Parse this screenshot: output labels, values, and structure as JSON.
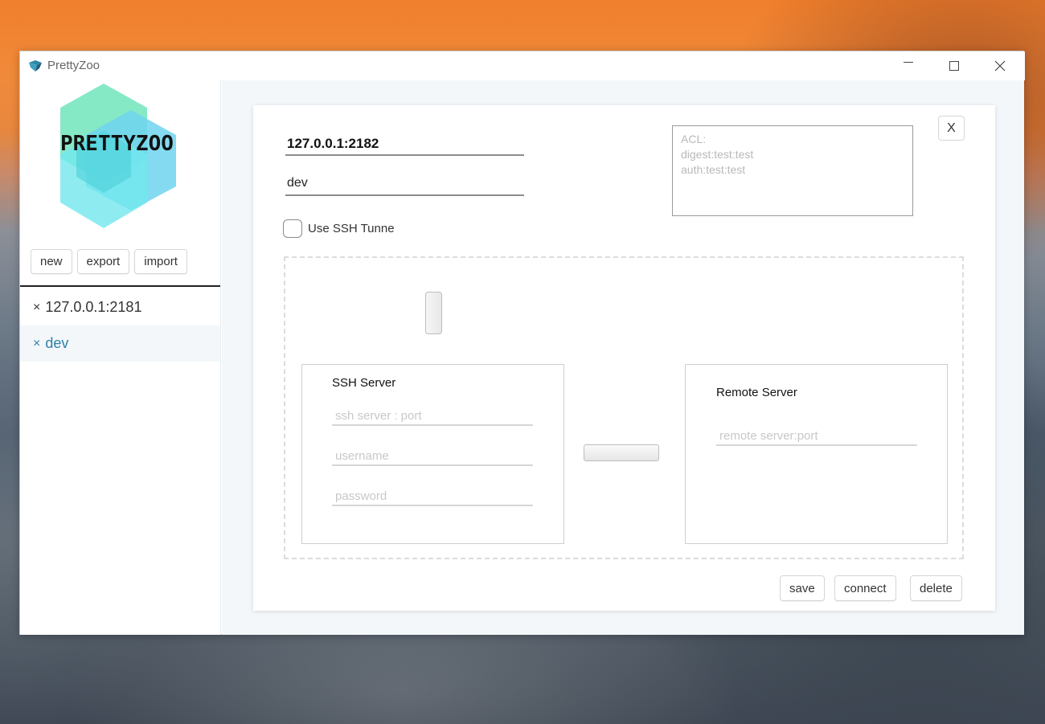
{
  "window": {
    "title": "PrettyZoo"
  },
  "logo": {
    "text": "PRETTYZOO"
  },
  "sidebar": {
    "buttons": {
      "new": "new",
      "export": "export",
      "import": "import"
    },
    "servers": [
      {
        "mark": "×",
        "label": "127.0.0.1:2181",
        "active": false
      },
      {
        "mark": "×",
        "label": "dev",
        "active": true
      }
    ]
  },
  "form": {
    "host": "127.0.0.1:2182",
    "alias": "dev",
    "acl_placeholder_lines": [
      "ACL:",
      "digest:test:test",
      "auth:test:test"
    ],
    "close_label": "X",
    "ssh_checkbox_label": "Use SSH Tunne",
    "ssh_checked": false,
    "ssh_server": {
      "title": "SSH Server",
      "server_placeholder": "ssh server : port",
      "username_placeholder": "username",
      "password_placeholder": "password"
    },
    "remote_server": {
      "title": "Remote Server",
      "server_placeholder": "remote server:port"
    },
    "actions": {
      "save": "save",
      "connect": "connect",
      "delete": "delete"
    }
  },
  "colors": {
    "active_item": "#2e7fa6",
    "active_item_bg": "#f3f7fa",
    "main_bg": "#f3f7fa"
  }
}
